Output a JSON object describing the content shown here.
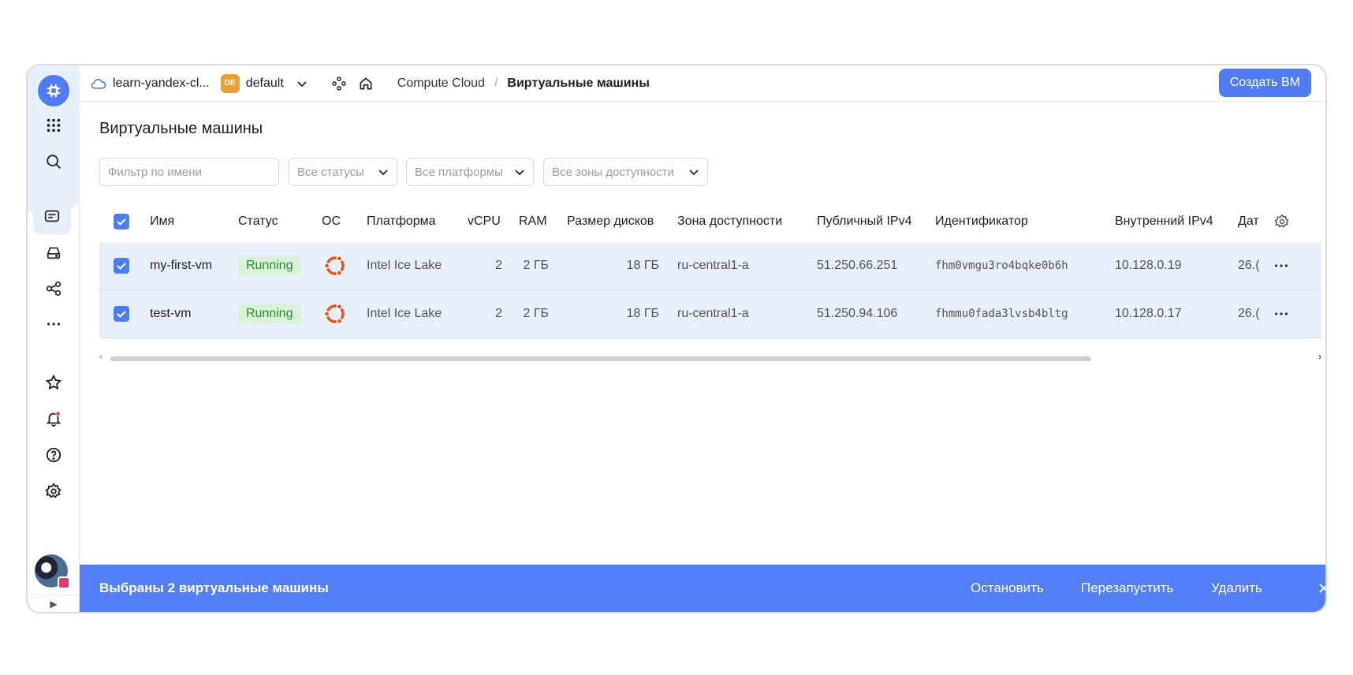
{
  "header": {
    "cloud_name": "learn-yandex-cl...",
    "folder_badge": "DE",
    "folder_name": "default",
    "service": "Compute Cloud",
    "crumb_sep": "/",
    "current_page": "Виртуальные машины",
    "create_button": "Создать ВМ"
  },
  "page": {
    "title": "Виртуальные машины"
  },
  "filters": {
    "name_placeholder": "Фильтр по имени",
    "status": "Все статусы",
    "platform": "Все платформы",
    "zone": "Все зоны доступности"
  },
  "table": {
    "columns": [
      "Имя",
      "Статус",
      "ОС",
      "Платформа",
      "vCPU",
      "RAM",
      "Размер дисков",
      "Зона доступности",
      "Публичный IPv4",
      "Идентификатор",
      "Внутренний IPv4",
      "Дат"
    ],
    "rows": [
      {
        "name": "my-first-vm",
        "status": "Running",
        "platform": "Intel Ice Lake",
        "vcpu": "2",
        "ram": "2 ГБ",
        "disk": "18 ГБ",
        "zone": "ru-central1-a",
        "public_ip": "51.250.66.251",
        "id": "fhm0vmgu3ro4bqke0b6h",
        "internal_ip": "10.128.0.19",
        "date": "26.("
      },
      {
        "name": "test-vm",
        "status": "Running",
        "platform": "Intel Ice Lake",
        "vcpu": "2",
        "ram": "2 ГБ",
        "disk": "18 ГБ",
        "zone": "ru-central1-a",
        "public_ip": "51.250.94.106",
        "id": "fhmmu0fada3lvsb4bltg",
        "internal_ip": "10.128.0.17",
        "date": "26.("
      }
    ]
  },
  "selection_bar": {
    "text": "Выбраны 2 виртуальные машины",
    "stop": "Остановить",
    "restart": "Перезапустить",
    "delete": "Удалить"
  },
  "colors": {
    "accent": "#4f7bf3",
    "selected_row": "#e7eefc",
    "status_running_bg": "#d9f2d8",
    "ubuntu": "#e95420"
  }
}
